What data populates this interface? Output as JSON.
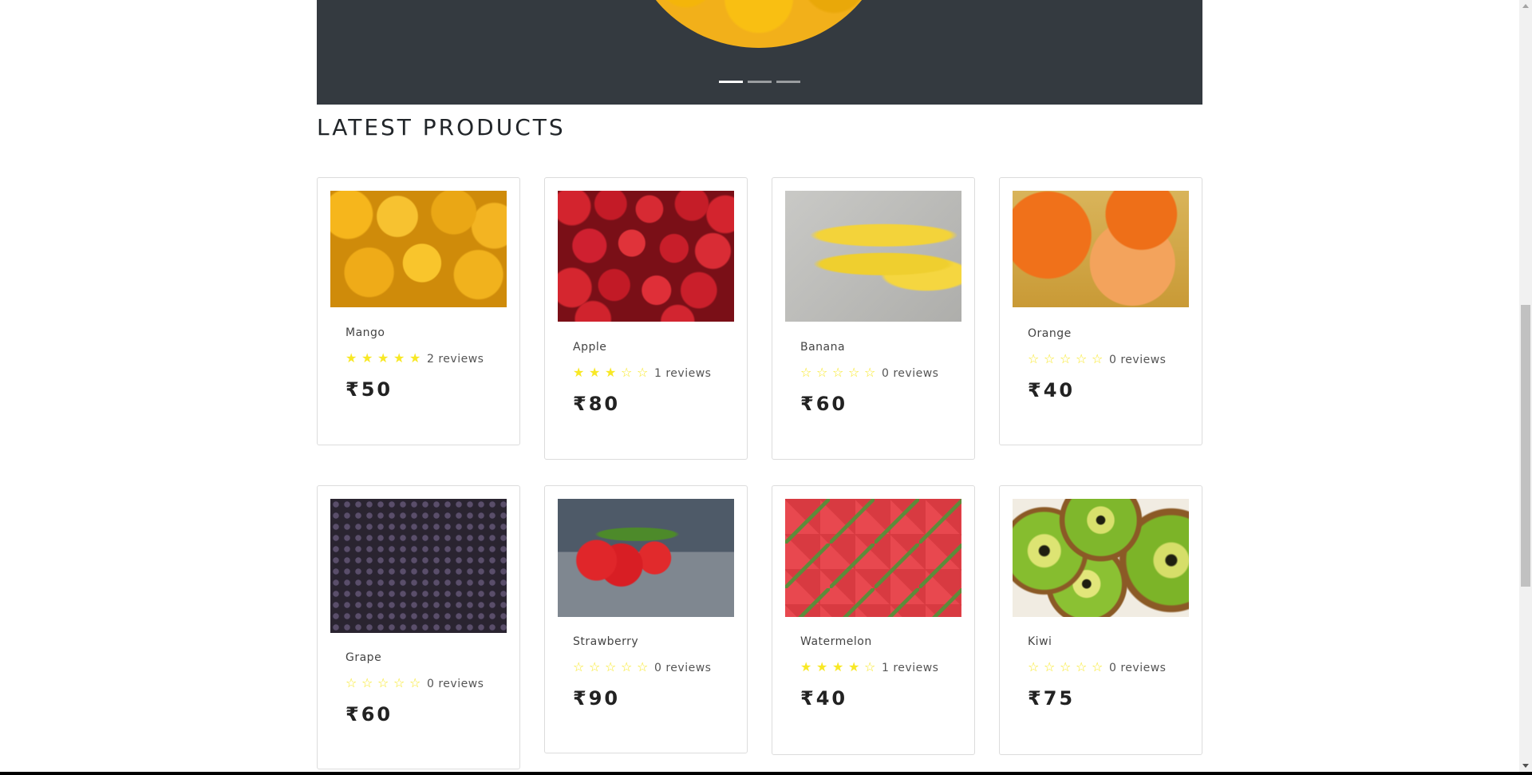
{
  "carousel": {
    "indicator_count": 3,
    "active_index": 0
  },
  "section": {
    "title": "LATEST PRODUCTS"
  },
  "products": [
    {
      "name": "Mango",
      "rating": 5,
      "reviews": "2 reviews",
      "price": "₹50",
      "image": "mango"
    },
    {
      "name": "Apple",
      "rating": 3,
      "reviews": "1 reviews",
      "price": "₹80",
      "image": "apple"
    },
    {
      "name": "Banana",
      "rating": 0,
      "reviews": "0 reviews",
      "price": "₹60",
      "image": "banana"
    },
    {
      "name": "Orange",
      "rating": 0,
      "reviews": "0 reviews",
      "price": "₹40",
      "image": "orange"
    },
    {
      "name": "Grape",
      "rating": 0,
      "reviews": "0 reviews",
      "price": "₹60",
      "image": "grape"
    },
    {
      "name": "Strawberry",
      "rating": 0,
      "reviews": "0 reviews",
      "price": "₹90",
      "image": "strawberry"
    },
    {
      "name": "Watermelon",
      "rating": 4,
      "reviews": "1 reviews",
      "price": "₹40",
      "image": "watermelon"
    },
    {
      "name": "Kiwi",
      "rating": 0,
      "reviews": "0 reviews",
      "price": "₹75",
      "image": "kiwi"
    }
  ],
  "colors": {
    "carousel_bg": "#343a40",
    "star": "#f8e825",
    "card_border": "#dcdcdc"
  },
  "icons": {
    "star_full": "star-filled-icon",
    "star_empty": "star-outline-icon"
  }
}
